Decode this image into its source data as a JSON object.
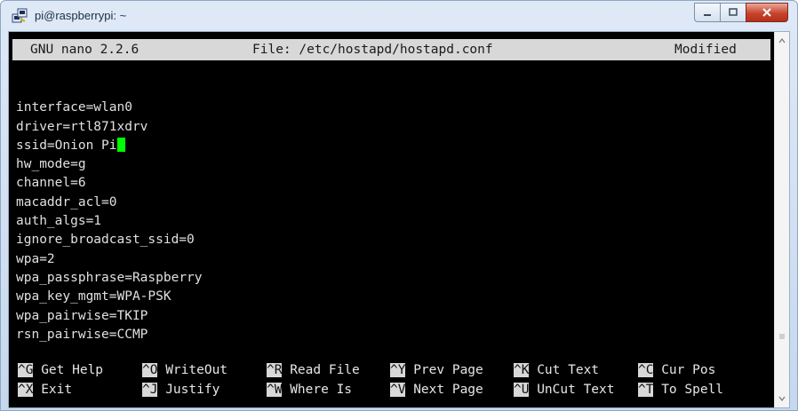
{
  "window": {
    "title": "pi@raspberrypi: ~",
    "icon": "putty-icon",
    "colors": {
      "frame": "#c6d8ee",
      "close": "#c8432a"
    }
  },
  "nano": {
    "header": {
      "version": "GNU nano 2.2.6",
      "file": "File: /etc/hostapd/hostapd.conf",
      "status": "Modified"
    },
    "lines": [
      "",
      "interface=wlan0",
      "driver=rtl871xdrv",
      "ssid=Onion Pi",
      "hw_mode=g",
      "channel=6",
      "macaddr_acl=0",
      "auth_algs=1",
      "ignore_broadcast_ssid=0",
      "wpa=2",
      "wpa_passphrase=Raspberry",
      "wpa_key_mgmt=WPA-PSK",
      "wpa_pairwise=TKIP",
      "rsn_pairwise=CCMP"
    ],
    "cursor_color": "#00ff00",
    "shortcuts_row1": [
      {
        "key": "^G",
        "label": " Get Help"
      },
      {
        "key": "^O",
        "label": " WriteOut"
      },
      {
        "key": "^R",
        "label": " Read File"
      },
      {
        "key": "^Y",
        "label": " Prev Page"
      },
      {
        "key": "^K",
        "label": " Cut Text"
      },
      {
        "key": "^C",
        "label": " Cur Pos"
      }
    ],
    "shortcuts_row2": [
      {
        "key": "^X",
        "label": " Exit"
      },
      {
        "key": "^J",
        "label": " Justify"
      },
      {
        "key": "^W",
        "label": " Where Is"
      },
      {
        "key": "^V",
        "label": " Next Page"
      },
      {
        "key": "^U",
        "label": " UnCut Text"
      },
      {
        "key": "^T",
        "label": " To Spell"
      }
    ]
  }
}
